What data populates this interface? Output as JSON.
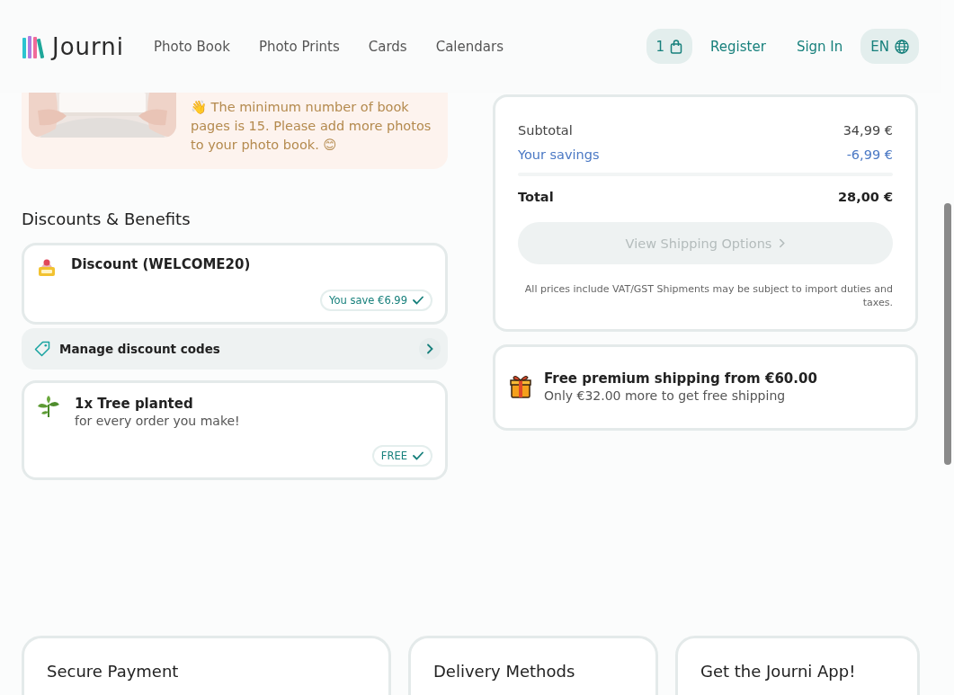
{
  "header": {
    "logo": "Journi",
    "nav": [
      {
        "label": "Photo Book"
      },
      {
        "label": "Photo Prints"
      },
      {
        "label": "Cards"
      },
      {
        "label": "Calendars"
      }
    ],
    "cart_count": "1",
    "links": [
      {
        "label": "Register"
      },
      {
        "label": "Sign In"
      }
    ],
    "language": "EN"
  },
  "banner": {
    "message": "👋 The minimum number of book pages is 15. Please add more photos to your photo book. 😊"
  },
  "discounts": {
    "title": "Discounts & Benefits",
    "items": [
      {
        "kind": "discount",
        "title": "Discount (WELCOME20)",
        "badge": "You save €6.99"
      },
      {
        "kind": "manage",
        "title": "Manage discount codes"
      },
      {
        "kind": "tree",
        "title": "1x Tree planted",
        "subtitle": "for every order you make!",
        "badge": "FREE"
      }
    ]
  },
  "summary": {
    "rows": [
      {
        "kind": "normal",
        "label": "Subtotal",
        "value": "34,99 €"
      },
      {
        "kind": "savings",
        "label": "Your savings",
        "value": "-6,99 €"
      },
      {
        "kind": "total",
        "label": "Total",
        "value": "28,00 €"
      }
    ],
    "button": {
      "label": "View Shipping Options",
      "disabled": true
    },
    "note": "All prices include VAT/GST Shipments may be subject to import duties and taxes."
  },
  "shipping": {
    "title": "Free premium shipping from €60.00",
    "subtitle": "Only €32.00 more to get free shipping"
  },
  "footer_cards": [
    {
      "title": "Secure Payment"
    },
    {
      "title": "Delivery Methods"
    },
    {
      "title": "Get the Journi App!"
    }
  ]
}
